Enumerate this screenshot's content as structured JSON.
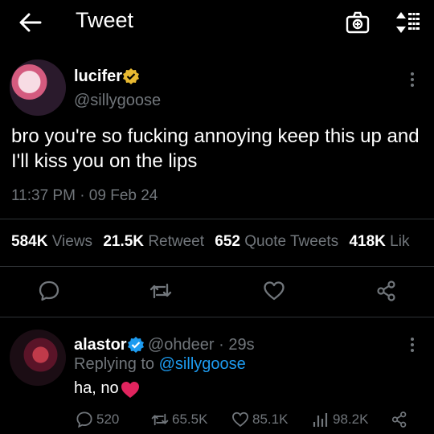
{
  "header": {
    "title": "Tweet",
    "back_icon": "arrow-left-icon",
    "camera_icon": "camera-icon",
    "sort_icon": "sort-icon"
  },
  "tweet": {
    "name": "lucifer",
    "handle": "@sillygoose",
    "text": "bro you're so fucking annoying keep this up and I'll kiss you on the lips",
    "timestamp": "11:37 PM · 09 Feb 24",
    "stats": {
      "views": "584K",
      "views_label": "Views",
      "retweets": "21.5K",
      "retweets_label": "Retweet",
      "quotes": "652",
      "quotes_label": "Quote Tweets",
      "likes": "418K",
      "likes_label": "Lik"
    }
  },
  "reply": {
    "name": "alastor",
    "handle": "@ohdeer",
    "age": "· 29s",
    "replying_prefix": "Replying to",
    "replying_handle": "@sillygoose",
    "text": "ha, no",
    "replies": "520",
    "retweets": "65.5K",
    "likes": "85.1K",
    "views": "98.2K"
  },
  "colors": {
    "accent": "#1d9bf0",
    "gold_badge": "#e8b931",
    "muted": "#71767b",
    "heart": "#e0245e"
  }
}
